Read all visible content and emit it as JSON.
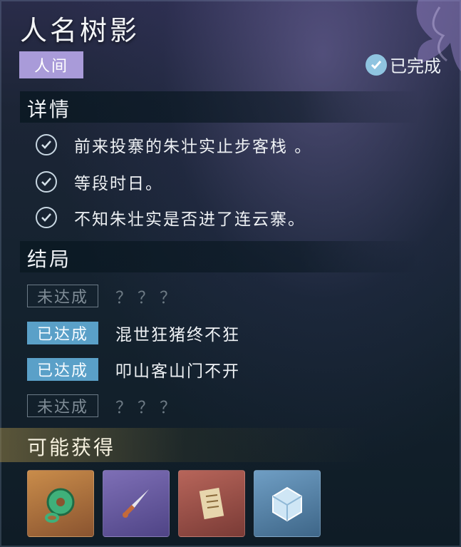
{
  "header": {
    "title": "人名树影",
    "tag": "人间",
    "status": "已完成"
  },
  "details": {
    "heading": "详情",
    "items": [
      "前来投寨的朱壮实止步客栈 。",
      "等段时日。",
      "不知朱壮实是否进了连云寨。"
    ]
  },
  "endings": {
    "heading": "结局",
    "items": [
      {
        "badge": "未达成",
        "text": "？？？",
        "state": "undone"
      },
      {
        "badge": "已达成",
        "text": "混世狂猪终不狂",
        "state": "done"
      },
      {
        "badge": "已达成",
        "text": "叩山客山门不开",
        "state": "done"
      },
      {
        "badge": "未达成",
        "text": "？？？",
        "state": "undone"
      }
    ]
  },
  "rewards": {
    "heading": "可能获得",
    "items": [
      {
        "icon": "jade-pendant-icon",
        "rarity_color": "#c98c4a"
      },
      {
        "icon": "dagger-icon",
        "rarity_color": "#7e6fb6"
      },
      {
        "icon": "book-icon",
        "rarity_color": "#b7655a"
      },
      {
        "icon": "ice-cube-icon",
        "rarity_color": "#6f9ec4"
      }
    ]
  },
  "colors": {
    "tag_bg": "#a99bd9",
    "done_badge": "#5aa0c8",
    "check": "#8fc4e0"
  }
}
